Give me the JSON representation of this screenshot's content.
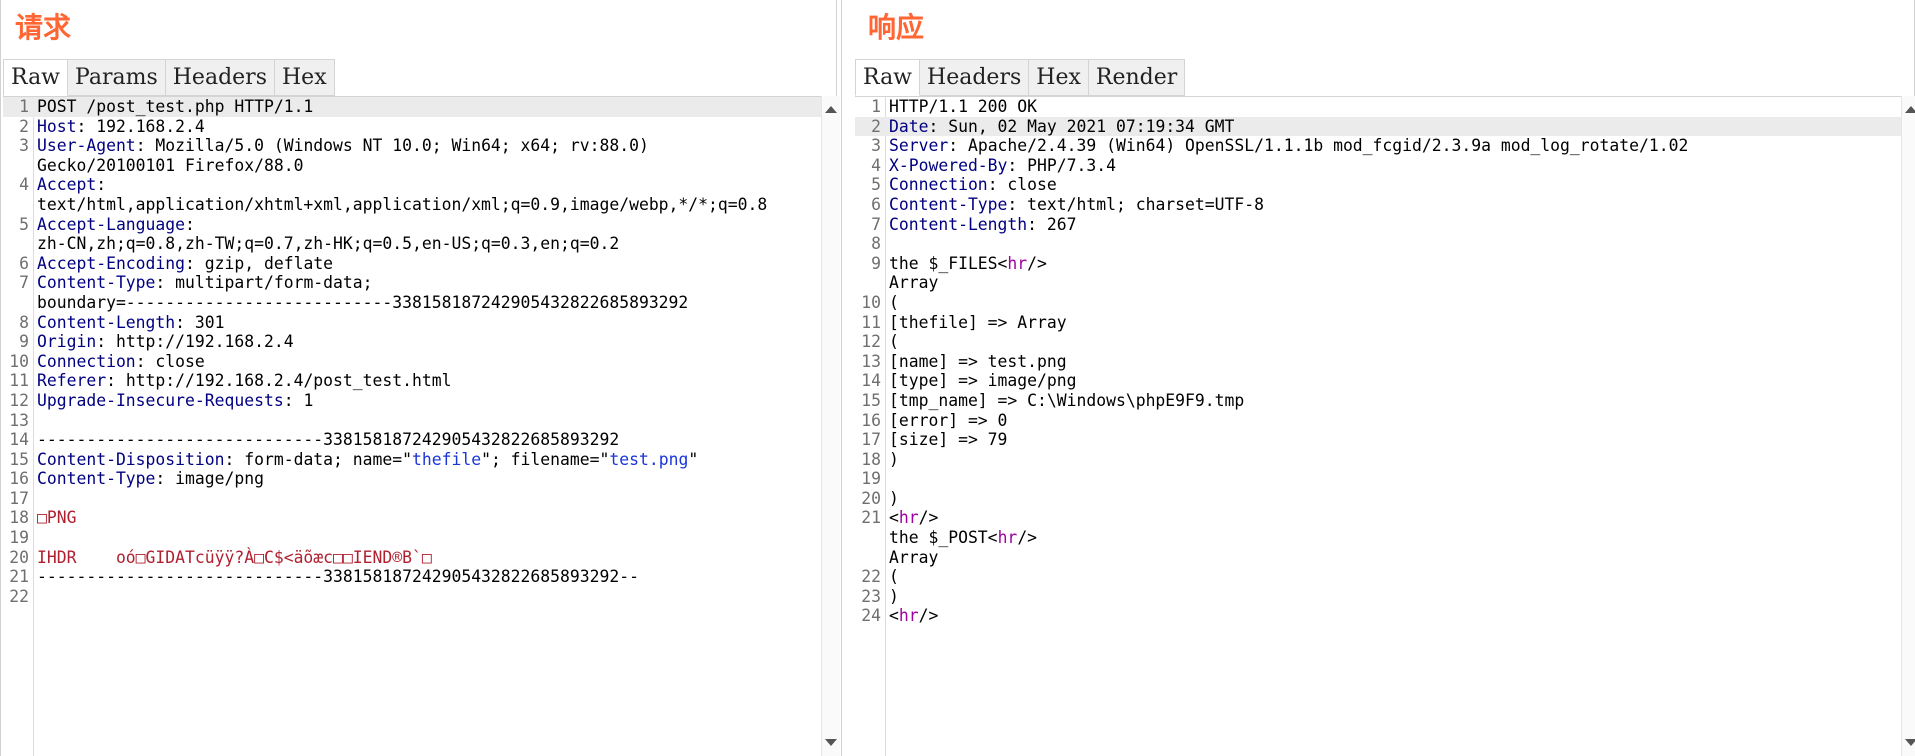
{
  "request": {
    "title": "请求",
    "tabs": [
      "Raw",
      "Params",
      "Headers",
      "Hex"
    ],
    "lines": [
      {
        "n": "1",
        "parts": [
          {
            "t": "POST /post_test.php HTTP/1.1",
            "c": "hv"
          }
        ]
      },
      {
        "n": "2",
        "parts": [
          {
            "t": "Host",
            "c": "hk"
          },
          {
            "t": ": 192.168.2.4",
            "c": "hv"
          }
        ]
      },
      {
        "n": "3",
        "parts": [
          {
            "t": "User-Agent",
            "c": "hk"
          },
          {
            "t": ": Mozilla/5.0 (Windows NT 10.0; Win64; x64; rv:88.0)",
            "c": "hv"
          }
        ]
      },
      {
        "n": "",
        "parts": [
          {
            "t": "Gecko/20100101 Firefox/88.0",
            "c": "hv"
          }
        ]
      },
      {
        "n": "4",
        "parts": [
          {
            "t": "Accept",
            "c": "hk"
          },
          {
            "t": ":",
            "c": "hv"
          }
        ]
      },
      {
        "n": "",
        "parts": [
          {
            "t": "text/html,application/xhtml+xml,application/xml;q=0.9,image/webp,*/*;q=0.8",
            "c": "hv"
          }
        ]
      },
      {
        "n": "5",
        "parts": [
          {
            "t": "Accept-Language",
            "c": "hk"
          },
          {
            "t": ":",
            "c": "hv"
          }
        ]
      },
      {
        "n": "",
        "parts": [
          {
            "t": "zh-CN,zh;q=0.8,zh-TW;q=0.7,zh-HK;q=0.5,en-US;q=0.3,en;q=0.2",
            "c": "hv"
          }
        ]
      },
      {
        "n": "6",
        "parts": [
          {
            "t": "Accept-Encoding",
            "c": "hk"
          },
          {
            "t": ": gzip, deflate",
            "c": "hv"
          }
        ]
      },
      {
        "n": "7",
        "parts": [
          {
            "t": "Content-Type",
            "c": "hk"
          },
          {
            "t": ": multipart/form-data;",
            "c": "hv"
          }
        ]
      },
      {
        "n": "",
        "parts": [
          {
            "t": "boundary=---------------------------338158187242905432822685893292",
            "c": "hv"
          }
        ]
      },
      {
        "n": "8",
        "parts": [
          {
            "t": "Content-Length",
            "c": "hk"
          },
          {
            "t": ": 301",
            "c": "hv"
          }
        ]
      },
      {
        "n": "9",
        "parts": [
          {
            "t": "Origin",
            "c": "hk"
          },
          {
            "t": ": http://192.168.2.4",
            "c": "hv"
          }
        ]
      },
      {
        "n": "10",
        "parts": [
          {
            "t": "Connection",
            "c": "hk"
          },
          {
            "t": ": close",
            "c": "hv"
          }
        ]
      },
      {
        "n": "11",
        "parts": [
          {
            "t": "Referer",
            "c": "hk"
          },
          {
            "t": ": http://192.168.2.4/post_test.html",
            "c": "hv"
          }
        ]
      },
      {
        "n": "12",
        "parts": [
          {
            "t": "Upgrade-Insecure-Requests",
            "c": "hk"
          },
          {
            "t": ": 1",
            "c": "hv"
          }
        ]
      },
      {
        "n": "13",
        "parts": []
      },
      {
        "n": "14",
        "parts": [
          {
            "t": "-----------------------------338158187242905432822685893292",
            "c": "hv"
          }
        ]
      },
      {
        "n": "15",
        "parts": [
          {
            "t": "Content-Disposition",
            "c": "hk"
          },
          {
            "t": ": form-data; name=\"",
            "c": "hv"
          },
          {
            "t": "thefile",
            "c": "q"
          },
          {
            "t": "\"; filename=\"",
            "c": "hv"
          },
          {
            "t": "test.png",
            "c": "q"
          },
          {
            "t": "\"",
            "c": "hv"
          }
        ]
      },
      {
        "n": "16",
        "parts": [
          {
            "t": "Content-Type",
            "c": "hk"
          },
          {
            "t": ": image/png",
            "c": "hv"
          }
        ]
      },
      {
        "n": "17",
        "parts": []
      },
      {
        "n": "18",
        "parts": [
          {
            "t": "□PNG",
            "c": "red"
          }
        ]
      },
      {
        "n": "19",
        "parts": []
      },
      {
        "n": "20",
        "parts": [
          {
            "t": "IHDR    oó□GIDATcüÿÿ?À□C$<äõæc□□IEND®B`□",
            "c": "red"
          }
        ]
      },
      {
        "n": "21",
        "parts": [
          {
            "t": "-----------------------------338158187242905432822685893292--",
            "c": "hv"
          }
        ]
      },
      {
        "n": "22",
        "parts": []
      }
    ]
  },
  "response": {
    "title": "响应",
    "tabs": [
      "Raw",
      "Headers",
      "Hex",
      "Render"
    ],
    "lines": [
      {
        "n": "1",
        "parts": [
          {
            "t": "HTTP/1.1 200 OK",
            "c": "hv"
          }
        ]
      },
      {
        "n": "2",
        "parts": [
          {
            "t": "Date",
            "c": "hk"
          },
          {
            "t": ": Sun, 02 May 2021 07:19:34 GMT",
            "c": "hv"
          }
        ]
      },
      {
        "n": "3",
        "parts": [
          {
            "t": "Server",
            "c": "hk"
          },
          {
            "t": ": Apache/2.4.39 (Win64) OpenSSL/1.1.1b mod_fcgid/2.3.9a mod_log_rotate/1.02",
            "c": "hv"
          }
        ]
      },
      {
        "n": "4",
        "parts": [
          {
            "t": "X-Powered-By",
            "c": "hk"
          },
          {
            "t": ": PHP/7.3.4",
            "c": "hv"
          }
        ]
      },
      {
        "n": "5",
        "parts": [
          {
            "t": "Connection",
            "c": "hk"
          },
          {
            "t": ": close",
            "c": "hv"
          }
        ]
      },
      {
        "n": "6",
        "parts": [
          {
            "t": "Content-Type",
            "c": "hk"
          },
          {
            "t": ": text/html; charset=UTF-8",
            "c": "hv"
          }
        ]
      },
      {
        "n": "7",
        "parts": [
          {
            "t": "Content-Length",
            "c": "hk"
          },
          {
            "t": ": 267",
            "c": "hv"
          }
        ]
      },
      {
        "n": "8",
        "parts": []
      },
      {
        "n": "9",
        "parts": [
          {
            "t": "the $_FILES<",
            "c": "hv"
          },
          {
            "t": "hr",
            "c": "tag"
          },
          {
            "t": "/>",
            "c": "hv"
          }
        ]
      },
      {
        "n": "",
        "parts": [
          {
            "t": "Array",
            "c": "hv"
          }
        ]
      },
      {
        "n": "10",
        "parts": [
          {
            "t": "(",
            "c": "hv"
          }
        ]
      },
      {
        "n": "11",
        "parts": [
          {
            "t": "[thefile] => Array",
            "c": "hv"
          }
        ]
      },
      {
        "n": "12",
        "parts": [
          {
            "t": "(",
            "c": "hv"
          }
        ]
      },
      {
        "n": "13",
        "parts": [
          {
            "t": "[name] => test.png",
            "c": "hv"
          }
        ]
      },
      {
        "n": "14",
        "parts": [
          {
            "t": "[type] => image/png",
            "c": "hv"
          }
        ]
      },
      {
        "n": "15",
        "parts": [
          {
            "t": "[tmp_name] => C:\\Windows\\phpE9F9.tmp",
            "c": "hv"
          }
        ]
      },
      {
        "n": "16",
        "parts": [
          {
            "t": "[error] => 0",
            "c": "hv"
          }
        ]
      },
      {
        "n": "17",
        "parts": [
          {
            "t": "[size] => 79",
            "c": "hv"
          }
        ]
      },
      {
        "n": "18",
        "parts": [
          {
            "t": ")",
            "c": "hv"
          }
        ]
      },
      {
        "n": "19",
        "parts": []
      },
      {
        "n": "20",
        "parts": [
          {
            "t": ")",
            "c": "hv"
          }
        ]
      },
      {
        "n": "21",
        "parts": [
          {
            "t": "<",
            "c": "hv"
          },
          {
            "t": "hr",
            "c": "tag"
          },
          {
            "t": "/>",
            "c": "hv"
          }
        ]
      },
      {
        "n": "",
        "parts": [
          {
            "t": "the $_POST<",
            "c": "hv"
          },
          {
            "t": "hr",
            "c": "tag"
          },
          {
            "t": "/>",
            "c": "hv"
          }
        ]
      },
      {
        "n": "",
        "parts": [
          {
            "t": "Array",
            "c": "hv"
          }
        ]
      },
      {
        "n": "22",
        "parts": [
          {
            "t": "(",
            "c": "hv"
          }
        ]
      },
      {
        "n": "23",
        "parts": [
          {
            "t": ")",
            "c": "hv"
          }
        ]
      },
      {
        "n": "24",
        "parts": [
          {
            "t": "<",
            "c": "hv"
          },
          {
            "t": "hr",
            "c": "tag"
          },
          {
            "t": "/>",
            "c": "hv"
          }
        ]
      }
    ]
  },
  "colors": {
    "title": "#ff6633",
    "header_key": "#000080",
    "quoted_value": "#1a36d8",
    "binary_data": "#b0202f",
    "html_tag": "#a000a0",
    "active_line": "#ebebeb"
  },
  "icons": [
    "chevron-up-icon",
    "chevron-down-icon"
  ]
}
